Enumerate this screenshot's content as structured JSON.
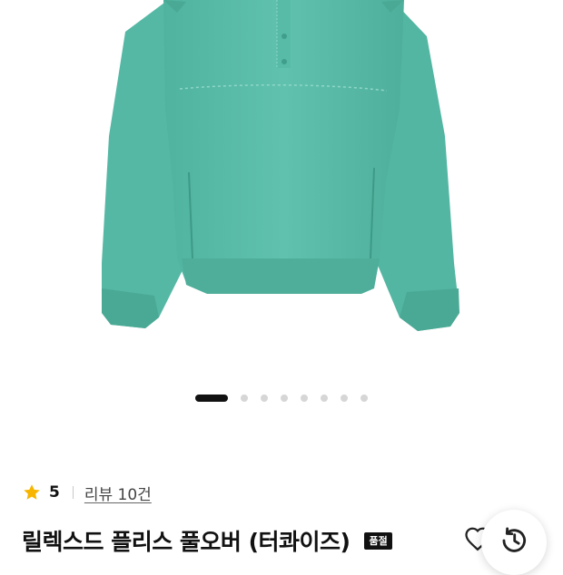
{
  "image_pager": {
    "total": 8,
    "active_index": 0
  },
  "product": {
    "rating": "5",
    "review_link": "리뷰 10건",
    "title": "릴렉스드 플리스 풀오버 (터콰이즈)",
    "status_badge": "품절"
  },
  "colors": {
    "fleece": "#5cbfac",
    "star": "#f7b500",
    "text": "#111111"
  },
  "icons": {
    "rating": "star-icon",
    "wishlist": "heart-outline-icon",
    "history": "history-clock-icon"
  }
}
